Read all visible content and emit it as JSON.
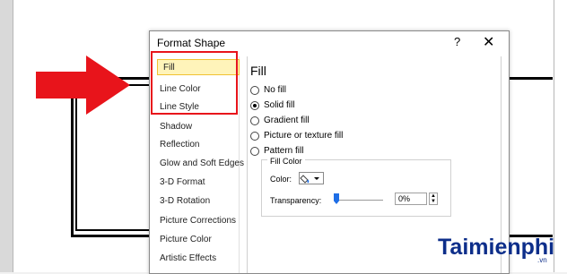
{
  "dialog": {
    "title": "Format Shape",
    "help": "?",
    "close": "✕"
  },
  "nav": {
    "items": [
      {
        "label": "Fill"
      },
      {
        "label": "Line Color"
      },
      {
        "label": "Line Style"
      },
      {
        "label": "Shadow"
      },
      {
        "label": "Reflection"
      },
      {
        "label": "Glow and Soft Edges"
      },
      {
        "label": "3-D Format"
      },
      {
        "label": "3-D Rotation"
      },
      {
        "label": "Picture Corrections"
      },
      {
        "label": "Picture Color"
      },
      {
        "label": "Artistic Effects"
      }
    ]
  },
  "fill": {
    "title": "Fill",
    "options": [
      {
        "label": "No fill"
      },
      {
        "label": "Solid fill"
      },
      {
        "label": "Gradient fill"
      },
      {
        "label": "Picture or texture fill"
      },
      {
        "label": "Pattern fill"
      }
    ],
    "group_title": "Fill Color",
    "color_label": "Color:",
    "transparency_label": "Transparency:",
    "transparency_value": "0%"
  },
  "watermark": {
    "brand": "Taimienphi",
    "suffix": ".vn"
  },
  "colors": {
    "arrow": "#e8141b",
    "highlight": "#e8141b",
    "selection": "#fff4ba"
  }
}
